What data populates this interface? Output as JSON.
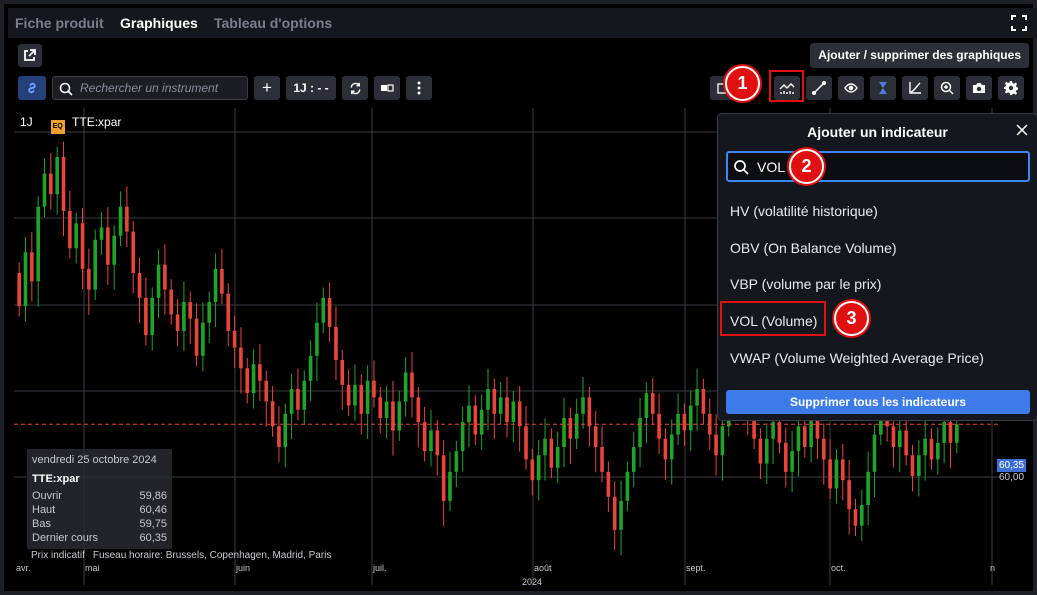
{
  "tabs": [
    {
      "label": "Fiche produit"
    },
    {
      "label": "Graphiques"
    },
    {
      "label": "Tableau d'options"
    }
  ],
  "header": {
    "add_remove_label": "Ajouter / supprimer des graphiques"
  },
  "toolbar": {
    "search_placeholder": "Rechercher un instrument",
    "add_label": "+",
    "period_label": "1J : - -"
  },
  "legend": {
    "period": "1J",
    "badge": "EQ",
    "symbol": "TTE:xpar"
  },
  "popup": {
    "title": "Ajouter un indicateur",
    "search_value": "VOL",
    "items": [
      "HV (volatilité historique)",
      "OBV (On Balance Volume)",
      "VBP (volume par le prix)",
      "VOL (Volume)",
      "VWAP (Volume Weighted Average Price)"
    ],
    "delete_all": "Supprimer tous les indicateurs"
  },
  "annotations": {
    "b1": "1",
    "b2": "2",
    "b3": "3"
  },
  "info": {
    "date": "vendredi 25 octobre 2024",
    "symbol": "TTE:xpar",
    "rows": [
      {
        "label": "Ouvrir",
        "value": "59,86"
      },
      {
        "label": "Haut",
        "value": "60,46"
      },
      {
        "label": "Bas",
        "value": "59,75"
      },
      {
        "label": "Dernier cours",
        "value": "60,35"
      }
    ]
  },
  "footer": {
    "prix": "Prix indicatif",
    "timezone": "Fuseau horaire: Brussels, Copenhagen, Madrid, Paris"
  },
  "price": {
    "current": "60,35",
    "level": "60,00"
  },
  "colors": {
    "up": "#1fa32a",
    "down": "#e8453c",
    "accent": "#3f86f5"
  },
  "chart_data": {
    "type": "candlestick",
    "symbol": "TTE:xpar",
    "x_ticks": [
      "avr.",
      "mai",
      "juin",
      "juil.",
      "août",
      "sept.",
      "oct.",
      "n"
    ],
    "year": "2024",
    "last_close": 60.35,
    "series": [
      {
        "o": 64.0,
        "c": 63.2
      },
      {
        "o": 63.2,
        "c": 64.5
      },
      {
        "o": 64.5,
        "c": 63.8
      },
      {
        "o": 63.8,
        "c": 65.6
      },
      {
        "o": 65.6,
        "c": 66.4
      },
      {
        "o": 66.4,
        "c": 65.9
      },
      {
        "o": 65.9,
        "c": 66.8
      },
      {
        "o": 66.8,
        "c": 65.5
      },
      {
        "o": 65.5,
        "c": 64.6
      },
      {
        "o": 64.6,
        "c": 65.2
      },
      {
        "o": 65.2,
        "c": 64.1
      },
      {
        "o": 64.1,
        "c": 63.6
      },
      {
        "o": 63.6,
        "c": 64.8
      },
      {
        "o": 64.8,
        "c": 65.1
      },
      {
        "o": 65.1,
        "c": 64.2
      },
      {
        "o": 64.2,
        "c": 64.9
      },
      {
        "o": 64.9,
        "c": 65.6
      },
      {
        "o": 65.6,
        "c": 65.0
      },
      {
        "o": 65.0,
        "c": 64.0
      },
      {
        "o": 64.0,
        "c": 63.4
      },
      {
        "o": 63.4,
        "c": 62.5
      },
      {
        "o": 62.5,
        "c": 63.4
      },
      {
        "o": 63.4,
        "c": 64.2
      },
      {
        "o": 64.2,
        "c": 63.6
      },
      {
        "o": 63.6,
        "c": 63.0
      },
      {
        "o": 63.0,
        "c": 62.6
      },
      {
        "o": 62.6,
        "c": 63.3
      },
      {
        "o": 63.3,
        "c": 62.9
      },
      {
        "o": 62.9,
        "c": 62.0
      },
      {
        "o": 62.0,
        "c": 62.8
      },
      {
        "o": 62.8,
        "c": 63.3
      },
      {
        "o": 63.3,
        "c": 64.1
      },
      {
        "o": 64.1,
        "c": 63.5
      },
      {
        "o": 63.5,
        "c": 62.6
      },
      {
        "o": 62.6,
        "c": 62.2
      },
      {
        "o": 62.2,
        "c": 61.7
      },
      {
        "o": 61.7,
        "c": 61.1
      },
      {
        "o": 61.1,
        "c": 61.8
      },
      {
        "o": 61.8,
        "c": 61.4
      },
      {
        "o": 61.4,
        "c": 60.9
      },
      {
        "o": 60.9,
        "c": 60.3
      },
      {
        "o": 60.3,
        "c": 59.8
      },
      {
        "o": 59.8,
        "c": 60.6
      },
      {
        "o": 60.6,
        "c": 61.2
      },
      {
        "o": 61.2,
        "c": 60.7
      },
      {
        "o": 60.7,
        "c": 61.4
      },
      {
        "o": 61.4,
        "c": 62.0
      },
      {
        "o": 62.0,
        "c": 62.8
      },
      {
        "o": 62.8,
        "c": 63.4
      },
      {
        "o": 63.4,
        "c": 62.7
      },
      {
        "o": 62.7,
        "c": 61.9
      },
      {
        "o": 61.9,
        "c": 61.3
      },
      {
        "o": 61.3,
        "c": 60.8
      },
      {
        "o": 60.8,
        "c": 61.3
      },
      {
        "o": 61.3,
        "c": 60.6
      },
      {
        "o": 60.6,
        "c": 61.4
      },
      {
        "o": 61.4,
        "c": 61.0
      },
      {
        "o": 61.0,
        "c": 60.5
      },
      {
        "o": 60.5,
        "c": 60.9
      },
      {
        "o": 60.9,
        "c": 60.2
      },
      {
        "o": 60.2,
        "c": 60.9
      },
      {
        "o": 60.9,
        "c": 61.6
      },
      {
        "o": 61.6,
        "c": 61.0
      },
      {
        "o": 61.0,
        "c": 60.4
      },
      {
        "o": 60.4,
        "c": 59.7
      },
      {
        "o": 59.7,
        "c": 60.2
      },
      {
        "o": 60.2,
        "c": 59.6
      },
      {
        "o": 59.6,
        "c": 58.5
      },
      {
        "o": 58.5,
        "c": 59.2
      },
      {
        "o": 59.2,
        "c": 59.7
      },
      {
        "o": 59.7,
        "c": 60.4
      },
      {
        "o": 60.4,
        "c": 60.8
      },
      {
        "o": 60.8,
        "c": 60.1
      },
      {
        "o": 60.1,
        "c": 60.7
      },
      {
        "o": 60.7,
        "c": 61.2
      },
      {
        "o": 61.2,
        "c": 60.6
      },
      {
        "o": 60.6,
        "c": 61.0
      },
      {
        "o": 61.0,
        "c": 60.4
      },
      {
        "o": 60.4,
        "c": 60.9
      },
      {
        "o": 60.9,
        "c": 60.3
      },
      {
        "o": 60.3,
        "c": 59.5
      },
      {
        "o": 59.5,
        "c": 59.0
      },
      {
        "o": 59.0,
        "c": 59.6
      },
      {
        "o": 59.6,
        "c": 60.0
      },
      {
        "o": 60.0,
        "c": 59.3
      },
      {
        "o": 59.3,
        "c": 59.8
      },
      {
        "o": 59.8,
        "c": 60.5
      },
      {
        "o": 60.5,
        "c": 60.0
      },
      {
        "o": 60.0,
        "c": 60.6
      },
      {
        "o": 60.6,
        "c": 61.0
      },
      {
        "o": 61.0,
        "c": 60.3
      },
      {
        "o": 60.3,
        "c": 59.8
      },
      {
        "o": 59.8,
        "c": 59.2
      },
      {
        "o": 59.2,
        "c": 58.6
      },
      {
        "o": 58.6,
        "c": 57.8
      },
      {
        "o": 57.8,
        "c": 58.5
      },
      {
        "o": 58.5,
        "c": 59.2
      },
      {
        "o": 59.2,
        "c": 59.8
      },
      {
        "o": 59.8,
        "c": 60.5
      },
      {
        "o": 60.5,
        "c": 61.1
      },
      {
        "o": 61.1,
        "c": 60.6
      },
      {
        "o": 60.6,
        "c": 60.0
      },
      {
        "o": 60.0,
        "c": 59.5
      },
      {
        "o": 59.5,
        "c": 60.1
      },
      {
        "o": 60.1,
        "c": 60.6
      },
      {
        "o": 60.6,
        "c": 60.2
      },
      {
        "o": 60.2,
        "c": 60.8
      },
      {
        "o": 60.8,
        "c": 61.2
      },
      {
        "o": 61.2,
        "c": 60.6
      },
      {
        "o": 60.6,
        "c": 60.1
      },
      {
        "o": 60.1,
        "c": 59.6
      },
      {
        "o": 59.6,
        "c": 60.3
      },
      {
        "o": 60.3,
        "c": 61.0
      },
      {
        "o": 61.0,
        "c": 61.6
      },
      {
        "o": 61.6,
        "c": 61.2
      },
      {
        "o": 61.2,
        "c": 60.7
      },
      {
        "o": 60.7,
        "c": 60.0
      },
      {
        "o": 60.0,
        "c": 59.4
      },
      {
        "o": 59.4,
        "c": 60.0
      },
      {
        "o": 60.0,
        "c": 60.4
      },
      {
        "o": 60.4,
        "c": 59.9
      },
      {
        "o": 59.9,
        "c": 59.2
      },
      {
        "o": 59.2,
        "c": 59.7
      },
      {
        "o": 59.7,
        "c": 60.3
      },
      {
        "o": 60.3,
        "c": 59.8
      },
      {
        "o": 59.8,
        "c": 60.5
      },
      {
        "o": 60.5,
        "c": 60.0
      },
      {
        "o": 60.0,
        "c": 59.5
      },
      {
        "o": 59.5,
        "c": 58.8
      },
      {
        "o": 58.8,
        "c": 59.5
      },
      {
        "o": 59.5,
        "c": 59.0
      },
      {
        "o": 59.0,
        "c": 58.3
      },
      {
        "o": 58.3,
        "c": 57.9
      },
      {
        "o": 57.9,
        "c": 58.4
      },
      {
        "o": 58.4,
        "c": 59.2
      },
      {
        "o": 59.2,
        "c": 60.1
      },
      {
        "o": 60.1,
        "c": 60.8
      },
      {
        "o": 60.8,
        "c": 60.3
      },
      {
        "o": 60.3,
        "c": 59.8
      },
      {
        "o": 59.8,
        "c": 60.2
      },
      {
        "o": 60.2,
        "c": 59.6
      },
      {
        "o": 59.6,
        "c": 59.1
      },
      {
        "o": 59.1,
        "c": 59.6
      },
      {
        "o": 59.6,
        "c": 60.0
      },
      {
        "o": 60.0,
        "c": 59.5
      },
      {
        "o": 59.5,
        "c": 59.9
      },
      {
        "o": 59.9,
        "c": 60.4
      },
      {
        "o": 60.4,
        "c": 59.9
      },
      {
        "o": 59.9,
        "c": 60.35
      }
    ],
    "y_range": [
      57.0,
      67.5
    ]
  }
}
